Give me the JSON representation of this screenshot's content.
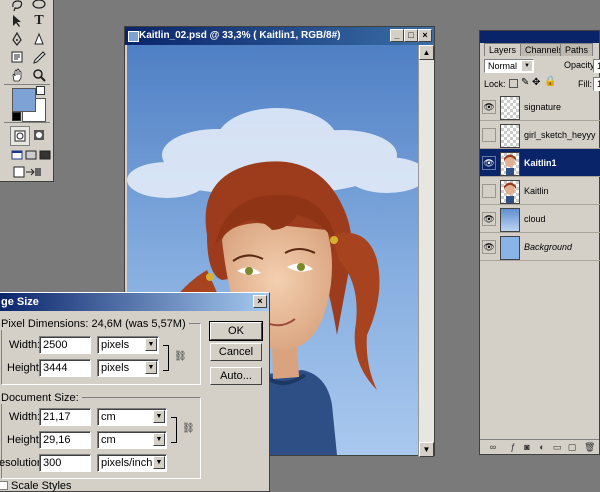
{
  "document": {
    "title": "Kaitlin_02.psd @ 33,3% ( Kaitlin1, RGB/8#)",
    "buttons": {
      "minimize": "_",
      "maximize": "□",
      "close": "×"
    }
  },
  "toolbox": {
    "foreground_color": "#7fa2d6",
    "background_color": "#ffffff",
    "tools": [
      "lasso-icon",
      "magic-wand-icon",
      "move-icon",
      "type-icon",
      "pen-icon",
      "shape-icon",
      "notes-icon",
      "eyedropper-icon",
      "hand-icon",
      "zoom-icon"
    ]
  },
  "layers_panel": {
    "tabs": [
      "Layers",
      "Channels",
      "Paths"
    ],
    "active_tab": "Layers",
    "blend_mode": "Normal",
    "opacity_label": "Opacity:",
    "opacity_value": "1",
    "lock_label": "Lock:",
    "fill_label": "Fill:",
    "fill_value": "1",
    "layers": [
      {
        "name": "signature",
        "visible": true,
        "selected": false,
        "italic": false,
        "thumb": "transparent"
      },
      {
        "name": "girl_sketch_heyyy",
        "visible": false,
        "selected": false,
        "italic": false,
        "thumb": "transparent"
      },
      {
        "name": "Kaitlin1",
        "visible": true,
        "selected": true,
        "italic": false,
        "thumb": "girl"
      },
      {
        "name": "Kaitlin",
        "visible": false,
        "selected": false,
        "italic": false,
        "thumb": "girl"
      },
      {
        "name": "cloud",
        "visible": true,
        "selected": false,
        "italic": false,
        "thumb": "cloud"
      },
      {
        "name": "Background",
        "visible": true,
        "selected": false,
        "italic": true,
        "thumb": "blue"
      }
    ]
  },
  "image_size_dialog": {
    "title": "ge Size",
    "close": "×",
    "pixel_dimensions_label": "Pixel Dimensions:",
    "pixel_dimensions_value": "24,6M (was 5,57M)",
    "width_label": "Width:",
    "width_value": "2500",
    "width_unit": "pixels",
    "height_label": "Height:",
    "height_value": "3444",
    "height_unit": "pixels",
    "document_size_label": "Document Size:",
    "doc_width_label": "Width:",
    "doc_width_value": "21,17",
    "doc_width_unit": "cm",
    "doc_height_label": "Height:",
    "doc_height_value": "29,16",
    "doc_height_unit": "cm",
    "resolution_label": "esolution:",
    "resolution_value": "300",
    "resolution_unit": "pixels/inch",
    "scale_styles_label": "Scale Styles",
    "ok_label": "OK",
    "cancel_label": "Cancel",
    "auto_label": "Auto..."
  }
}
